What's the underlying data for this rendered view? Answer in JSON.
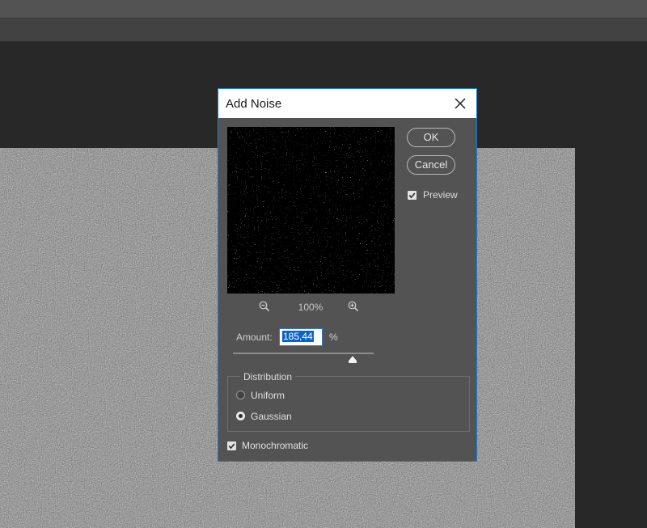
{
  "dialog": {
    "title": "Add Noise",
    "ok_label": "OK",
    "cancel_label": "Cancel",
    "preview_label": "Preview",
    "preview_checked": true,
    "zoom_level": "100%",
    "amount_label": "Amount:",
    "amount_value": "185,44",
    "amount_unit": "%",
    "distribution": {
      "legend": "Distribution",
      "options": [
        "Uniform",
        "Gaussian"
      ],
      "selected": "Gaussian"
    },
    "monochromatic_label": "Monochromatic",
    "monochromatic_checked": true
  },
  "icons": {
    "close": "close-icon",
    "zoom_out": "zoom-out-icon",
    "zoom_in": "zoom-in-icon",
    "check": "checkmark-icon",
    "slider": "slider-triangle-icon"
  },
  "colors": {
    "accent": "#1c7ad0",
    "dialog_bg": "#535353",
    "workspace_bg": "#282828",
    "selection": "#0a64c8"
  }
}
